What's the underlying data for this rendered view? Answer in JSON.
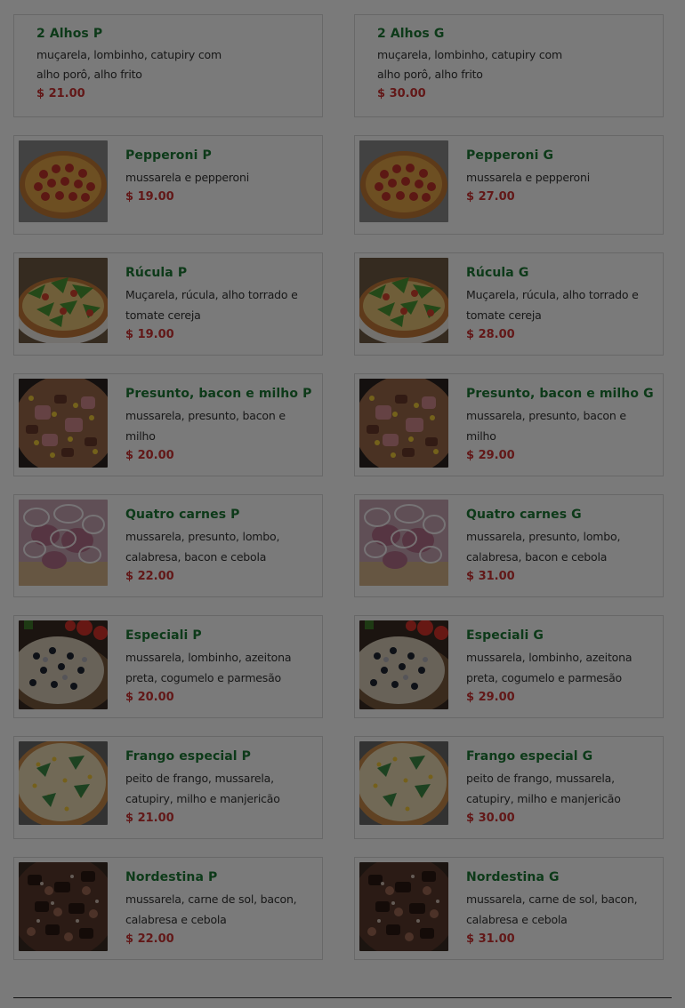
{
  "menu": {
    "items": [
      {
        "name": "2 Alhos P",
        "desc": "muçarela, lombinho, catupiry com alho porô, alho frito",
        "price": "$ 21.00"
      },
      {
        "name": "2 Alhos G",
        "desc": "muçarela, lombinho, catupiry com alho porô, alho frito",
        "price": "$ 30.00"
      },
      {
        "name": "Pepperoni P",
        "desc": "mussarela e pepperoni",
        "price": "$ 19.00",
        "image": "pepperoni-pizza"
      },
      {
        "name": "Pepperoni G",
        "desc": "mussarela e pepperoni",
        "price": "$ 27.00",
        "image": "pepperoni-pizza"
      },
      {
        "name": "Rúcula P",
        "desc": "Muçarela, rúcula, alho torrado e tomate cereja",
        "price": "$ 19.00",
        "image": "rucula-pizza"
      },
      {
        "name": "Rúcula G",
        "desc": "Muçarela, rúcula, alho torrado e tomate cereja",
        "price": "$ 28.00",
        "image": "rucula-pizza"
      },
      {
        "name": "Presunto, bacon e milho P",
        "desc": "mussarela, presunto, bacon e milho",
        "price": "$ 20.00",
        "image": "presunto-bacon-milho-pizza"
      },
      {
        "name": "Presunto, bacon e milho G",
        "desc": "mussarela, presunto, bacon e milho",
        "price": "$ 29.00",
        "image": "presunto-bacon-milho-pizza"
      },
      {
        "name": "Quatro carnes P",
        "desc": "mussarela, presunto, lombo, calabresa, bacon e cebola",
        "price": "$ 22.00",
        "image": "quatro-carnes-pizza"
      },
      {
        "name": "Quatro carnes G",
        "desc": "mussarela, presunto, lombo, calabresa, bacon e cebola",
        "price": "$ 31.00",
        "image": "quatro-carnes-pizza"
      },
      {
        "name": "Especiali P",
        "desc": "mussarela, lombinho, azeitona preta, cogumelo e parmesão",
        "price": "$ 20.00",
        "image": "especiali-pizza"
      },
      {
        "name": "Especiali G",
        "desc": "mussarela, lombinho, azeitona preta, cogumelo e parmesão",
        "price": "$ 29.00",
        "image": "especiali-pizza"
      },
      {
        "name": "Frango especial P",
        "desc": "peito de frango, mussarela, catupiry, milho e manjericão",
        "price": "$ 21.00",
        "image": "frango-especial-pizza"
      },
      {
        "name": "Frango especial G",
        "desc": "peito de frango, mussarela, catupiry, milho e manjericão",
        "price": "$ 30.00",
        "image": "frango-especial-pizza"
      },
      {
        "name": "Nordestina P",
        "desc": "mussarela, carne de sol, bacon, calabresa e cebola",
        "price": "$ 22.00",
        "image": "nordestina-pizza"
      },
      {
        "name": "Nordestina G",
        "desc": "mussarela, carne de sol, bacon, calabresa e cebola",
        "price": "$ 31.00",
        "image": "nordestina-pizza"
      }
    ]
  },
  "colors": {
    "item_name": "#1d7a36",
    "item_price": "#cc3333",
    "card_border": "#d9d9d9",
    "modal_overlay": "rgba(0,0,0,0.52)"
  }
}
